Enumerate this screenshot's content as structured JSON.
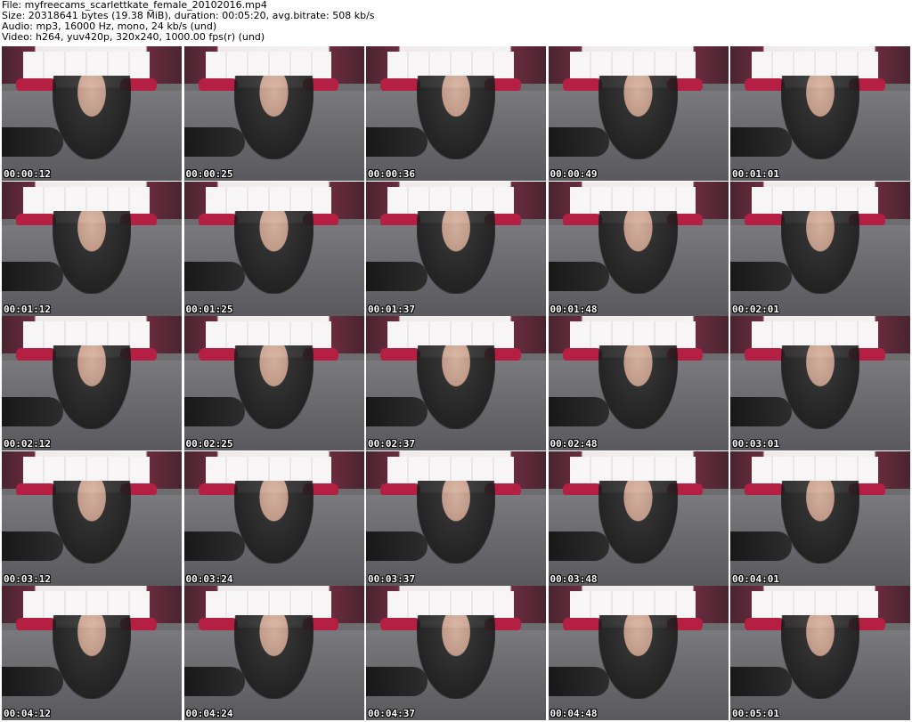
{
  "info": {
    "file": "File: myfreecams_scarlettkate_female_20102016.mp4",
    "size": "Size: 20318641 bytes (19.38 MiB), duration: 00:05:20, avg.bitrate: 508 kb/s",
    "audio": "Audio: mp3, 16000 Hz, mono, 24 kb/s (und)",
    "video": "Video: h264, yuv420p, 320x240, 1000.00 fps(r) (und)"
  },
  "thumbnails": [
    {
      "time": "00:00:12"
    },
    {
      "time": "00:00:25"
    },
    {
      "time": "00:00:36"
    },
    {
      "time": "00:00:49"
    },
    {
      "time": "00:01:01"
    },
    {
      "time": "00:01:12"
    },
    {
      "time": "00:01:25"
    },
    {
      "time": "00:01:37"
    },
    {
      "time": "00:01:48"
    },
    {
      "time": "00:02:01"
    },
    {
      "time": "00:02:12"
    },
    {
      "time": "00:02:25"
    },
    {
      "time": "00:02:37"
    },
    {
      "time": "00:02:48"
    },
    {
      "time": "00:03:01"
    },
    {
      "time": "00:03:12"
    },
    {
      "time": "00:03:24"
    },
    {
      "time": "00:03:37"
    },
    {
      "time": "00:03:48"
    },
    {
      "time": "00:04:01"
    },
    {
      "time": "00:04:12"
    },
    {
      "time": "00:04:24"
    },
    {
      "time": "00:04:37"
    },
    {
      "time": "00:04:48"
    },
    {
      "time": "00:05:01"
    }
  ]
}
